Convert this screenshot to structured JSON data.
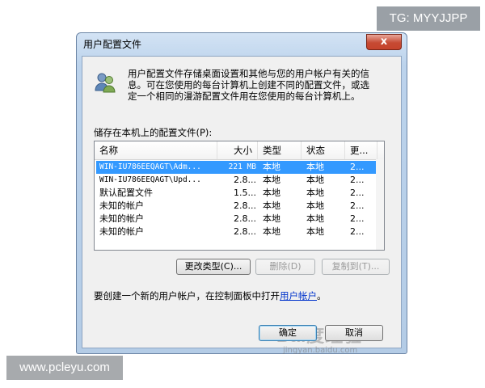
{
  "watermark": {
    "tg": "TG: MYYJJPP",
    "site": "www.pcleyu.com",
    "baidu": "Bai度经验",
    "baidu_url": "jingyan.baidu.com"
  },
  "dialog": {
    "title": "用户配置文件",
    "close_label": "x",
    "desc_line1": "用户配置文件存储桌面设置和其他与您的用户帐户有关的信",
    "desc_line2": "息。可在您使用的每台计算机上创建不同的配置文件，或选",
    "desc_line3": "定一个相同的漫游配置文件用在您使用的每台计算机上。",
    "list_label": "储存在本机上的配置文件(P):",
    "columns": {
      "name": "名称",
      "size": "大小",
      "type": "类型",
      "status": "状态",
      "more": "更..."
    },
    "rows": [
      {
        "name": "WIN-IU786EEQAGT\\Adm...",
        "size": "221 MB",
        "type": "本地",
        "status": "本地",
        "more": "2..."
      },
      {
        "name": "WIN-IU786EEQAGT\\Upd...",
        "size": "2.8...",
        "type": "本地",
        "status": "本地",
        "more": "2..."
      },
      {
        "name": "默认配置文件",
        "size": "1.5...",
        "type": "本地",
        "status": "本地",
        "more": "2..."
      },
      {
        "name": "未知的帐户",
        "size": "2.8...",
        "type": "本地",
        "status": "本地",
        "more": "2..."
      },
      {
        "name": "未知的帐户",
        "size": "2.8...",
        "type": "本地",
        "status": "本地",
        "more": "2..."
      },
      {
        "name": "未知的帐户",
        "size": "2.8...",
        "type": "本地",
        "status": "本地",
        "more": "2..."
      }
    ],
    "buttons": {
      "change_type": "更改类型(C)...",
      "delete": "删除(D)",
      "copy_to": "复制到(T)..."
    },
    "info_text": "要创建一个新的用户帐户，在控制面板中打开",
    "info_link": "用户帐户",
    "info_end": "。",
    "ok": "确定",
    "cancel": "取消"
  }
}
